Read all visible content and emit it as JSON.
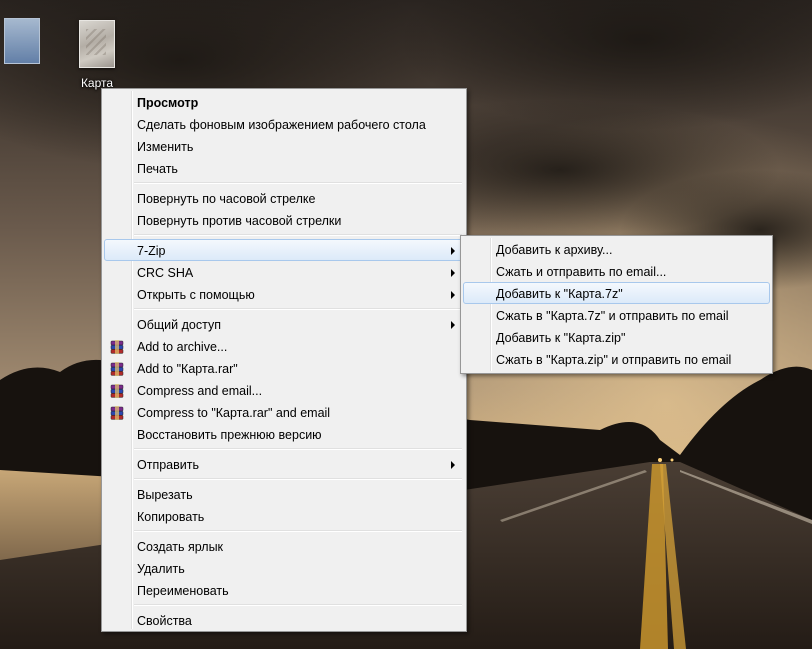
{
  "desktop": {
    "icons": [
      {
        "label": "Карта"
      }
    ]
  },
  "context_menu": {
    "groups": [
      [
        {
          "label": "Просмотр",
          "bold": true
        },
        {
          "label": "Сделать фоновым изображением рабочего стола"
        },
        {
          "label": "Изменить"
        },
        {
          "label": "Печать"
        }
      ],
      [
        {
          "label": "Повернуть по часовой стрелке"
        },
        {
          "label": "Повернуть против часовой стрелки"
        }
      ],
      [
        {
          "label": "7-Zip",
          "submenu": true,
          "highlighted": true
        },
        {
          "label": "CRC SHA",
          "submenu": true
        },
        {
          "label": "Открыть с помощью",
          "submenu": true
        }
      ],
      [
        {
          "label": "Общий доступ",
          "submenu": true
        },
        {
          "label": "Add to archive...",
          "icon": "winrar-icon"
        },
        {
          "label": "Add to \"Карта.rar\"",
          "icon": "winrar-icon"
        },
        {
          "label": "Compress and email...",
          "icon": "winrar-icon"
        },
        {
          "label": "Compress to \"Карта.rar\" and email",
          "icon": "winrar-icon"
        },
        {
          "label": "Восстановить прежнюю версию"
        }
      ],
      [
        {
          "label": "Отправить",
          "submenu": true
        }
      ],
      [
        {
          "label": "Вырезать"
        },
        {
          "label": "Копировать"
        }
      ],
      [
        {
          "label": "Создать ярлык"
        },
        {
          "label": "Удалить"
        },
        {
          "label": "Переименовать"
        }
      ],
      [
        {
          "label": "Свойства"
        }
      ]
    ]
  },
  "submenu_7zip": {
    "items": [
      {
        "label": "Добавить к архиву..."
      },
      {
        "label": "Сжать и отправить по email..."
      },
      {
        "label": "Добавить к \"Карта.7z\"",
        "highlighted": true
      },
      {
        "label": "Сжать в \"Карта.7z\" и отправить по email"
      },
      {
        "label": "Добавить к \"Карта.zip\""
      },
      {
        "label": "Сжать в \"Карта.zip\" и отправить по email"
      }
    ]
  },
  "colors": {
    "menu_bg": "#f0f0f0",
    "menu_border": "#979797",
    "highlight_border": "#a8c8ec",
    "highlight_bg": "#dceaf9"
  }
}
